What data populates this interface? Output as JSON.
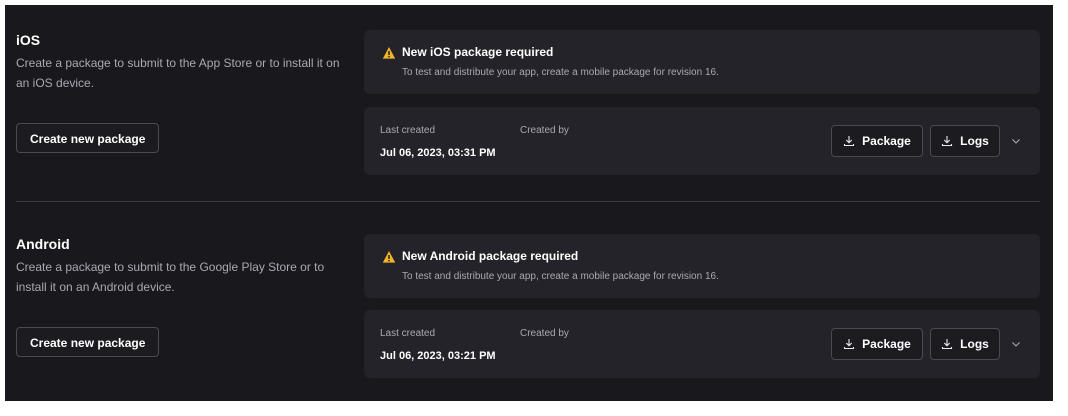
{
  "ios": {
    "title": "iOS",
    "description": "Create a package to submit to the App Store or to install it on an iOS device.",
    "create_button": "Create new package",
    "alert": {
      "title": "New iOS package required",
      "text": "To test and distribute your app, create a mobile package for revision 16."
    },
    "package": {
      "last_created_label": "Last created",
      "created_by_label": "Created by",
      "last_created_value": "Jul 06, 2023, 03:31 PM",
      "package_button": "Package",
      "logs_button": "Logs"
    }
  },
  "android": {
    "title": "Android",
    "description": "Create a package to submit to the Google Play Store or to install it on an Android device.",
    "create_button": "Create new package",
    "alert": {
      "title": "New Android package required",
      "text": "To test and distribute your app, create a mobile package for revision 16."
    },
    "package": {
      "last_created_label": "Last created",
      "created_by_label": "Created by",
      "last_created_value": "Jul 06, 2023, 03:21 PM",
      "package_button": "Package",
      "logs_button": "Logs"
    }
  },
  "colors": {
    "background": "#18181d",
    "card": "#232329",
    "warning": "#f0b429"
  },
  "icons": {
    "warning": "warning-triangle-icon",
    "download": "download-icon",
    "expand": "chevron-down-icon"
  }
}
